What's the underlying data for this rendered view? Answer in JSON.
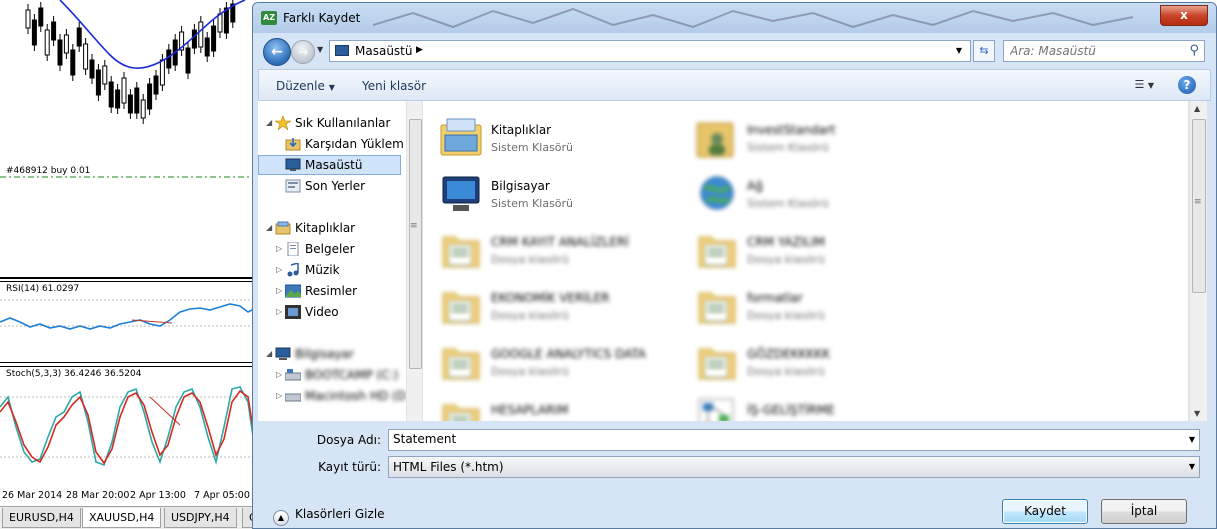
{
  "terminal": {
    "order_label": "#468912 buy 0.01",
    "rsi_label": "RSI(14) 61.0297",
    "stoch_label": "Stoch(5,3,3) 36.4246 36.5204",
    "dates": [
      "26 Mar 2014",
      "28 Mar 20:00",
      "2 Apr 13:00",
      "7 Apr 05:00"
    ],
    "tabs": [
      "EURUSD,H4",
      "XAUUSD,H4",
      "USDJPY,H4",
      "G"
    ]
  },
  "dialog": {
    "title": "Farklı Kaydet",
    "app_icon_text": "AZ",
    "close_glyph": "x",
    "address_location": "Masaüstü",
    "search_placeholder": "Ara: Masaüstü",
    "toolbar": {
      "organize_label": "Düzenle",
      "new_folder_label": "Yeni klasör"
    },
    "nav_tree": {
      "favorites_label": "Sık Kullanılanlar",
      "downloads_label": "Karşıdan Yüklem",
      "desktop_label": "Masaüstü",
      "recent_label": "Son Yerler",
      "libraries_label": "Kitaplıklar",
      "documents_label": "Belgeler",
      "music_label": "Müzik",
      "pictures_label": "Resimler",
      "video_label": "Video",
      "computer_label": "Bilgisayar",
      "drive1_label": "BOOTCAMP (C:)",
      "drive2_label": "Macintosh HD (D"
    },
    "files": [
      {
        "name": "Kitaplıklar",
        "type": "Sistem Klasörü",
        "icon": "libraries-icon",
        "blurred": false
      },
      {
        "name": "InvestStandart",
        "type": "Sistem Klasörü",
        "icon": "user-folder-icon",
        "blurred": true
      },
      {
        "name": "Bilgisayar",
        "type": "Sistem Klasörü",
        "icon": "computer-icon",
        "blurred": false
      },
      {
        "name": "Ağ",
        "type": "Sistem Klasörü",
        "icon": "network-icon",
        "blurred": true
      },
      {
        "name": "CRM KAYIT ANALİZLERİ",
        "type": "Dosya klasörü",
        "icon": "folder-icon",
        "blurred": true
      },
      {
        "name": "CRM YAZILIM",
        "type": "Dosya klasörü",
        "icon": "folder-icon",
        "blurred": true
      },
      {
        "name": "EKONOMİK VERİLER",
        "type": "Dosya klasörü",
        "icon": "folder-icon",
        "blurred": true
      },
      {
        "name": "formatlar",
        "type": "Dosya klasörü",
        "icon": "folder-icon",
        "blurred": true
      },
      {
        "name": "GOOGLE ANALYTICS DATA",
        "type": "Dosya klasörü",
        "icon": "folder-icon",
        "blurred": true
      },
      {
        "name": "GÖZDEKKKKK",
        "type": "Dosya klasörü",
        "icon": "folder-icon",
        "blurred": true
      },
      {
        "name": "HESAPLARIM",
        "type": "Dosya klasörü",
        "icon": "folder-icon",
        "blurred": true
      },
      {
        "name": "İŞ-GELİŞTİRME",
        "type": "Dosya klasörü",
        "icon": "diagram-icon",
        "blurred": true
      }
    ],
    "filename_label": "Dosya Adı:",
    "filename_value": "Statement",
    "filetype_label": "Kayıt türü:",
    "filetype_value": "HTML Files (*.htm)",
    "hide_folders_label": "Klasörleri Gizle",
    "save_label": "Kaydet",
    "cancel_label": "İptal"
  },
  "colors": {
    "selection_bg": "#cfe3fa",
    "dialog_frame": "#d6e5f5",
    "close_red": "#c8452a",
    "rsi_line": "#1e7fd8",
    "stoch_main": "#d42a20",
    "stoch_signal": "#2aa8a8",
    "ma_line": "#1a2ad8"
  }
}
